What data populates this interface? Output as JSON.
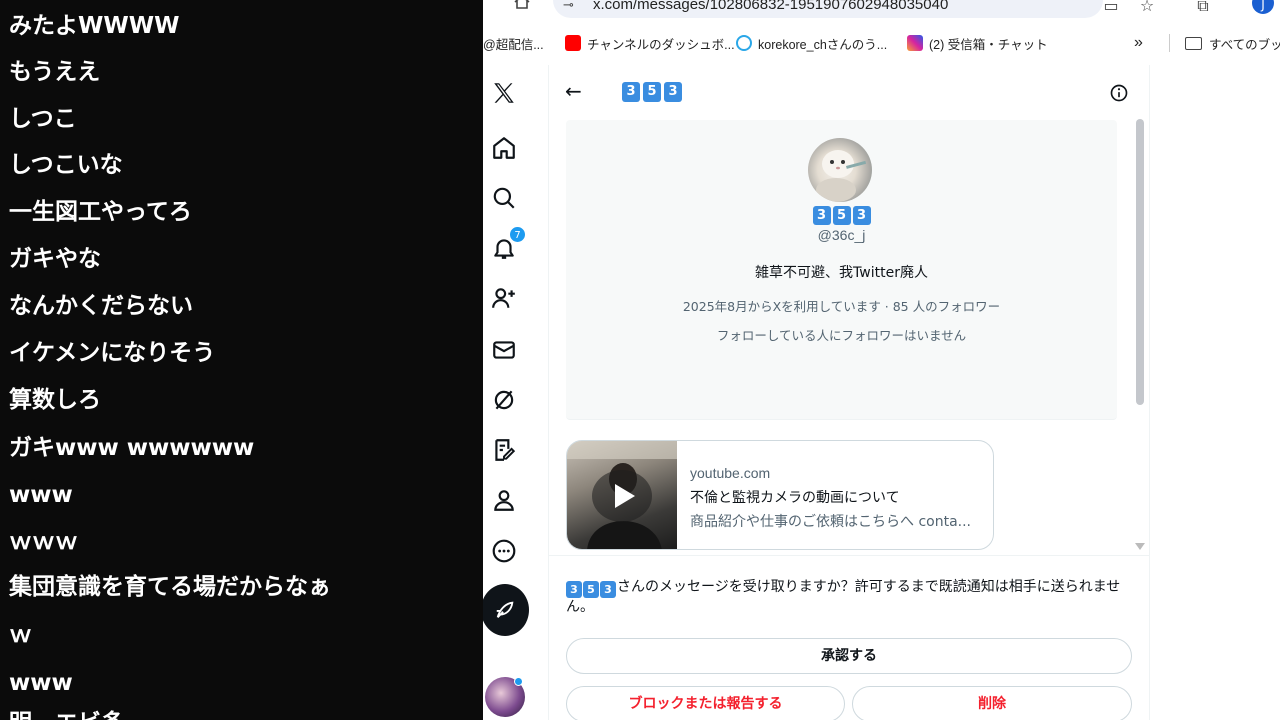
{
  "chat": {
    "lines": [
      "みたよWWWW",
      "もうええ",
      "しつこ",
      "しつこいな",
      "一生図工やってろ",
      "ガキやな",
      "なんかくだらない",
      "イケメンになりそう",
      "算数しろ",
      "ガキwww wwwwww",
      "www",
      "ｗｗｗ",
      "集団意識を育てる場だからなぁ",
      "ｗ",
      "www",
      "明　エビ多"
    ]
  },
  "browser": {
    "url": "x.com/messages/102806832-1951907602948035040",
    "profile_initial": "J",
    "bookmarks": [
      {
        "label": "@超配信...",
        "color": "#555555"
      },
      {
        "label": "チャンネルのダッシュボ...",
        "color": "#ff0000"
      },
      {
        "label": "korekore_chさんのう...",
        "color": "#2aa7e8"
      },
      {
        "label": "(2) 受信箱・チャット",
        "color": "#d6249f"
      },
      {
        "label": "»",
        "color": "#444444"
      },
      {
        "label": "すべてのブック",
        "color": "#444444"
      }
    ]
  },
  "nav": {
    "notifications_badge": "7",
    "items": [
      "x-logo-icon",
      "home-icon",
      "search-icon",
      "bell-icon",
      "follow-icon",
      "mail-icon",
      "grok-icon",
      "lists-icon",
      "profile-icon",
      "more-icon"
    ]
  },
  "conversation": {
    "title_digits": [
      "3",
      "5",
      "3"
    ],
    "profile": {
      "name_digits": [
        "3",
        "5",
        "3"
      ],
      "handle": "@36c_j",
      "bio": "雑草不可避、我Twitter廃人",
      "joined": "2025年8月からXを利用しています · 85 人のフォロワー",
      "follow_note": "フォローしている人にフォロワーはいません"
    },
    "link_card": {
      "domain": "youtube.com",
      "title": "不倫と監視カメラの動画について",
      "description": "商品紹介や仕事のご依頼はこちらへ conta..."
    },
    "request": {
      "digits": [
        "3",
        "5",
        "3"
      ],
      "text": "さんのメッセージを受け取りますか？許可するまで既読通知は相手に送られません。",
      "accept_label": "承認する",
      "block_label": "ブロックまたは報告する",
      "delete_label": "削除"
    }
  },
  "colors": {
    "accent": "#1d9bf0",
    "danger": "#f4212e",
    "emoji_key": "#3a8de0"
  }
}
